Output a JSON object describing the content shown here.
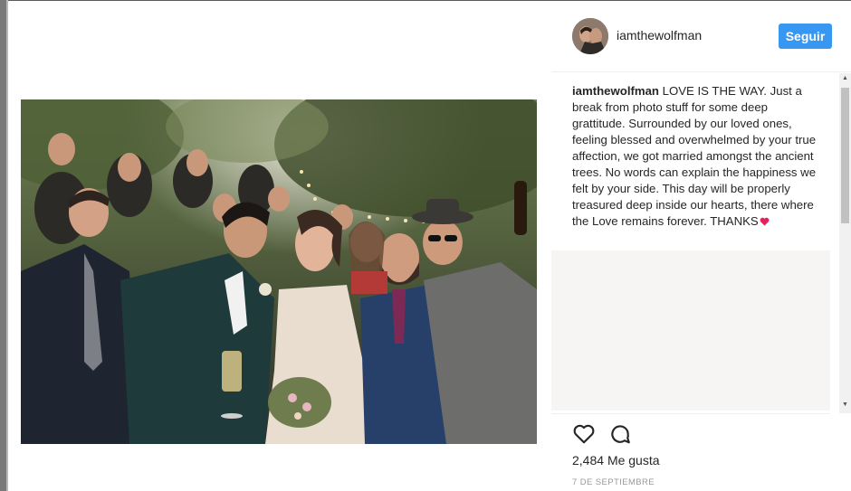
{
  "post": {
    "username": "iamthewolfman",
    "follow_label": "Seguir",
    "caption_user": "iamthewolfman",
    "caption_text": "LOVE IS THE WAY. Just a break from photo stuff for some deep grattitude. Surrounded by our loved ones, feeling blessed and overwhelmed by your true affection, we got married amongst the ancient trees. No words can explain the happiness we felt by your side. This day will be properly treasured deep inside our hearts, there where the Love remains forever. THANKS",
    "likes_count": "2,484",
    "likes_label": "Me gusta",
    "date": "7 DE SEPTIEMBRE"
  },
  "icons": {
    "like": "heart-icon",
    "comment": "comment-icon",
    "caption_emoji": "heart-emoji-icon"
  },
  "colors": {
    "follow_button": "#3897f0",
    "text": "#262626",
    "muted": "#999999",
    "heart_emoji": "#e0245e"
  }
}
